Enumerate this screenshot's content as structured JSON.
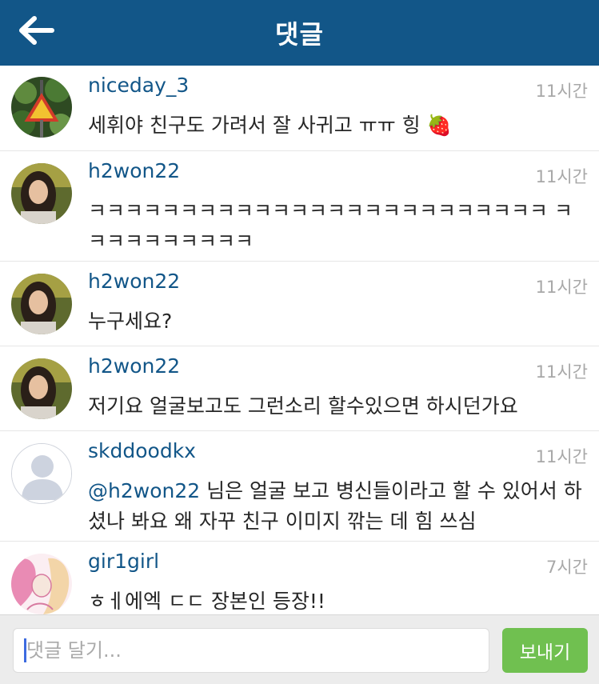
{
  "header": {
    "title": "댓글",
    "back_icon": "arrow-left-icon"
  },
  "comments": [
    {
      "username": "niceday_3",
      "time": "11시간",
      "text": "세휘야 친구도 가려서 잘 사귀고 ㅠㅠ 힝 🍓",
      "avatar": "photo-tree-sign"
    },
    {
      "username": "h2won22",
      "time": "11시간",
      "text": "ㅋㅋㅋㅋㅋㅋㅋㅋㅋㅋㅋㅋㅋㅋㅋㅋㅋㅋㅋㅋㅋㅋㅋㅋㅋ ㅋㅋㅋㅋㅋㅋㅋㅋㅋㅋ",
      "avatar": "photo-girl"
    },
    {
      "username": "h2won22",
      "time": "11시간",
      "text": "누구세요?",
      "avatar": "photo-girl"
    },
    {
      "username": "h2won22",
      "time": "11시간",
      "text": "저기요 얼굴보고도 그런소리 할수있으면 하시던가요",
      "avatar": "photo-girl"
    },
    {
      "username": "skddoodkx",
      "time": "11시간",
      "mention": "@h2won22",
      "text": " 님은 얼굴 보고 병신들이라고 할 수 있어서 하셨나 봐요 왜 자꾸 친구 이미지 깎는 데 힘 쓰심",
      "avatar": "default-avatar"
    },
    {
      "username": "gir1girl",
      "time": "7시간",
      "text": "ㅎㅔ에엑 ㄷㄷ 장본인 등장!!",
      "avatar": "illustration-pink"
    }
  ],
  "footer": {
    "placeholder": "댓글 달기...",
    "send_label": "보내기"
  },
  "colors": {
    "header_bg": "#125688",
    "username": "#125688",
    "send_button": "#70c050"
  }
}
